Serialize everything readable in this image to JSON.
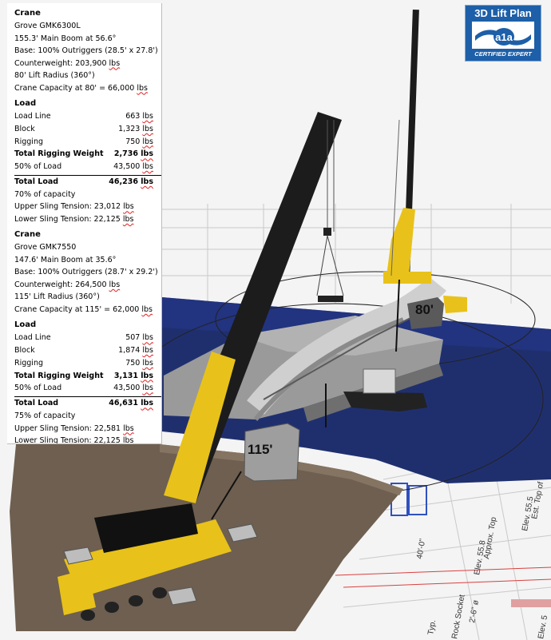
{
  "badge": {
    "title": "3D Lift Plan",
    "logo_text": "a1a",
    "subtitle": "CERTIFIED EXPERT"
  },
  "crane1": {
    "heading": "Crane",
    "model": "Grove GMK6300L",
    "boom": "155.3' Main Boom at 56.6°",
    "base": "Base: 100% Outriggers (28.5' x 27.8')",
    "counterweight_label": "Counterweight: 203,900",
    "lift_radius": "80' Lift Radius (360°)",
    "capacity_label": "Crane Capacity at 80' = 66,000",
    "load_heading": "Load",
    "load_line_label": "Load Line",
    "load_line_value": "663",
    "block_label": "Block",
    "block_value": "1,323",
    "rigging_label": "Rigging",
    "rigging_value": "750",
    "total_rigging_label": "Total Rigging Weight",
    "total_rigging_value": "2,736",
    "share_label": "50% of Load",
    "share_value": "43,500",
    "total_load_label": "Total Load",
    "total_load_value": "46,236",
    "capacity_pct": "70% of capacity",
    "upper_sling": "Upper Sling Tension: 23,012",
    "lower_sling": "Lower Sling Tension: 22,125"
  },
  "crane2": {
    "heading": "Crane",
    "model": "Grove GMK7550",
    "boom": "147.6' Main Boom at 35.6°",
    "base": "Base: 100% Outriggers (28.7' x 29.2')",
    "counterweight_label": "Counterweight: 264,500",
    "lift_radius": "115' Lift Radius (360°)",
    "capacity_label": "Crane Capacity at 115' = 62,000",
    "load_heading": "Load",
    "load_line_label": "Load Line",
    "load_line_value": "507",
    "block_label": "Block",
    "block_value": "1,874",
    "rigging_label": "Rigging",
    "rigging_value": "750",
    "total_rigging_label": "Total Rigging Weight",
    "total_rigging_value": "3,131",
    "share_label": "50% of Load",
    "share_value": "43,500",
    "total_load_label": "Total Load",
    "total_load_value": "46,631",
    "capacity_pct": "75% of capacity",
    "upper_sling": "Upper Sling Tension: 22,581",
    "lower_sling": "Lower Sling Tension: 22,125"
  },
  "unit": "lbs",
  "scene": {
    "radius_label_1": "80'",
    "radius_label_2": "115'",
    "plan_text_1": "Est. Top of Rock",
    "plan_text_2": "Elev. 55.5",
    "plan_text_3": "Approx. Top",
    "plan_text_4": "Elev. 55.8",
    "plan_text_5": "2'-6\" ø",
    "plan_text_6": "40'-0\"",
    "plan_text_7": "Rock Socket",
    "plan_text_8": "Typ.",
    "plan_text_9": "Elev. 5"
  },
  "colors": {
    "water": "#1f2f6e",
    "crane_yellow": "#e8c21a",
    "boom_black": "#1c1c1c",
    "ground": "#6e5f50",
    "deck": "#9a9a9a",
    "badge_blue": "#1d5fa8"
  }
}
